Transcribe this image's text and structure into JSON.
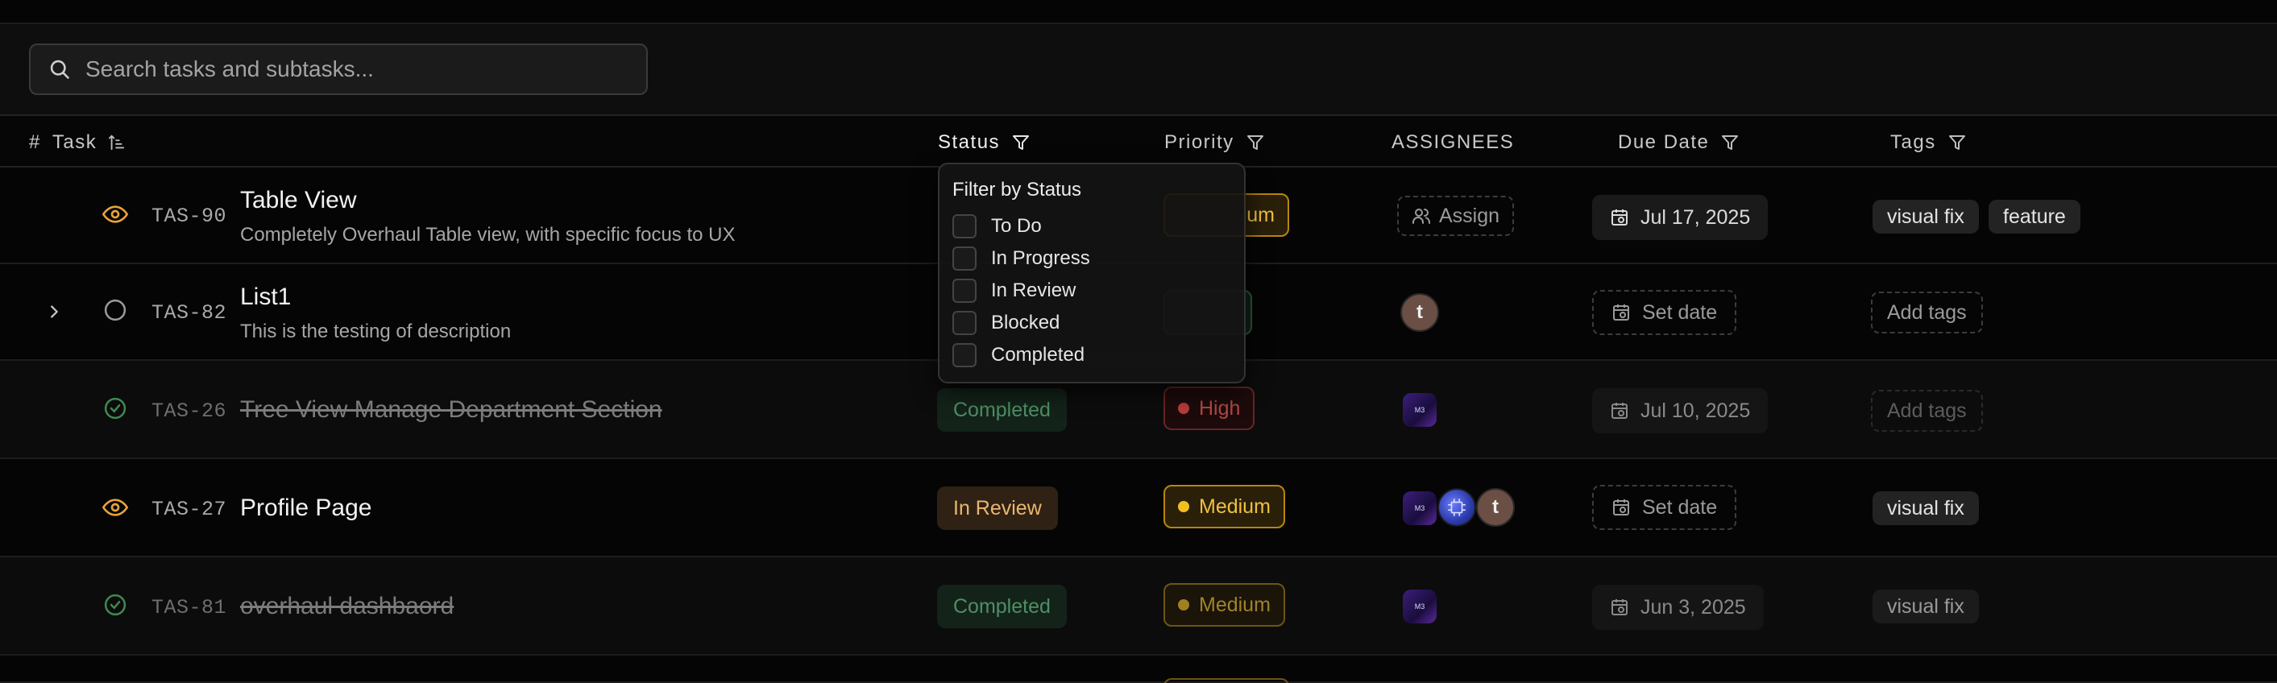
{
  "search": {
    "placeholder": "Search tasks and subtasks..."
  },
  "columns": {
    "hash": "#",
    "task": "Task",
    "status": "Status",
    "priority": "Priority",
    "assignees": "ASSIGNEES",
    "due_date": "Due Date",
    "tags": "Tags"
  },
  "rows": [
    {
      "id": "TAS-90",
      "icon": "eye-icon",
      "title": "Table View",
      "description": "Completely Overhaul Table view, with specific focus to UX",
      "status": "",
      "priority": "Medium",
      "priority_visible": "um",
      "assignees": {
        "action": "Assign"
      },
      "due_date": "Jul 17, 2025",
      "tags": [
        "visual fix",
        "feature"
      ]
    },
    {
      "id": "TAS-82",
      "icon": "circle-icon",
      "title": "List1",
      "description": "This is the testing of description",
      "assignees": {
        "letters": [
          "t"
        ]
      },
      "due_date": "Set date",
      "tags_action": "Add tags"
    },
    {
      "id": "TAS-26",
      "icon": "check-circle-icon",
      "title": "Tree View Manage Department Section",
      "status": "Completed",
      "priority": "High",
      "assignees": {
        "app_label": "M3"
      },
      "due_date": "Jul 10, 2025",
      "tags_action": "Add tags"
    },
    {
      "id": "TAS-27",
      "icon": "eye-icon",
      "title": "Profile Page",
      "status": "In Review",
      "priority": "Medium",
      "assignees": {
        "app_label": "M3",
        "letters": [
          "t"
        ]
      },
      "due_date": "Set date",
      "tags": [
        "visual fix"
      ]
    },
    {
      "id": "TAS-81",
      "icon": "check-circle-icon",
      "title": "overhaul dashbaord",
      "status": "Completed",
      "priority": "Medium",
      "assignees": {
        "app_label": "M3"
      },
      "due_date": "Jun 3, 2025",
      "tags": [
        "visual fix"
      ]
    }
  ],
  "status_filter": {
    "title": "Filter by Status",
    "options": [
      "To Do",
      "In Progress",
      "In Review",
      "Blocked",
      "Completed"
    ]
  },
  "colors": {
    "accent_eye": "#e8a33a",
    "completed_green": "#3f8a52",
    "medium_yellow": "#f0c020",
    "high_red": "#b83c3c"
  }
}
